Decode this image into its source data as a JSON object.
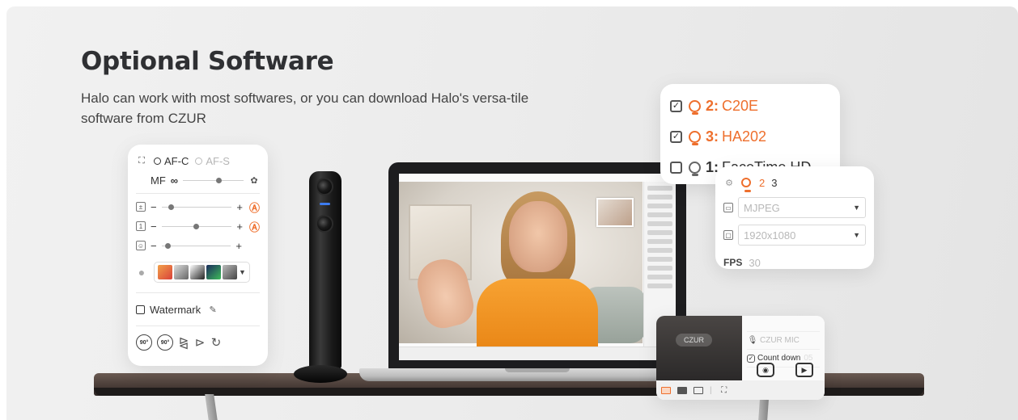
{
  "header": {
    "title": "Optional Software",
    "subtitle": "Halo can work with most softwares, or you can download Halo's versa-tile software from CZUR"
  },
  "control_panel": {
    "focus_af_c": "AF-C",
    "focus_af_s": "AF-S",
    "mf_label": "MF",
    "mf_infinity": "∞",
    "plus": "+",
    "minus": "−",
    "auto_icon": "auto-adjust-icon",
    "watermark_label": "Watermark",
    "rotate_left_label": "90°",
    "rotate_right_label": "90°",
    "colors": {
      "accent": "#ee6f2d"
    }
  },
  "device_list": {
    "items": [
      {
        "checked": true,
        "num": "2:",
        "name": "C20E"
      },
      {
        "checked": true,
        "num": "3:",
        "name": "HA202"
      },
      {
        "checked": false,
        "num": "1:",
        "name": "FaceTime HD"
      }
    ]
  },
  "format_panel": {
    "tab_2": "2",
    "tab_3": "3",
    "codec": "MJPEG",
    "resolution": "1920x1080",
    "fps_label": "FPS",
    "fps_value": "30"
  },
  "capture_panel": {
    "logo": "CZUR",
    "mic": "CZUR MIC",
    "countdown": "Count down",
    "countdown_value": "05"
  }
}
